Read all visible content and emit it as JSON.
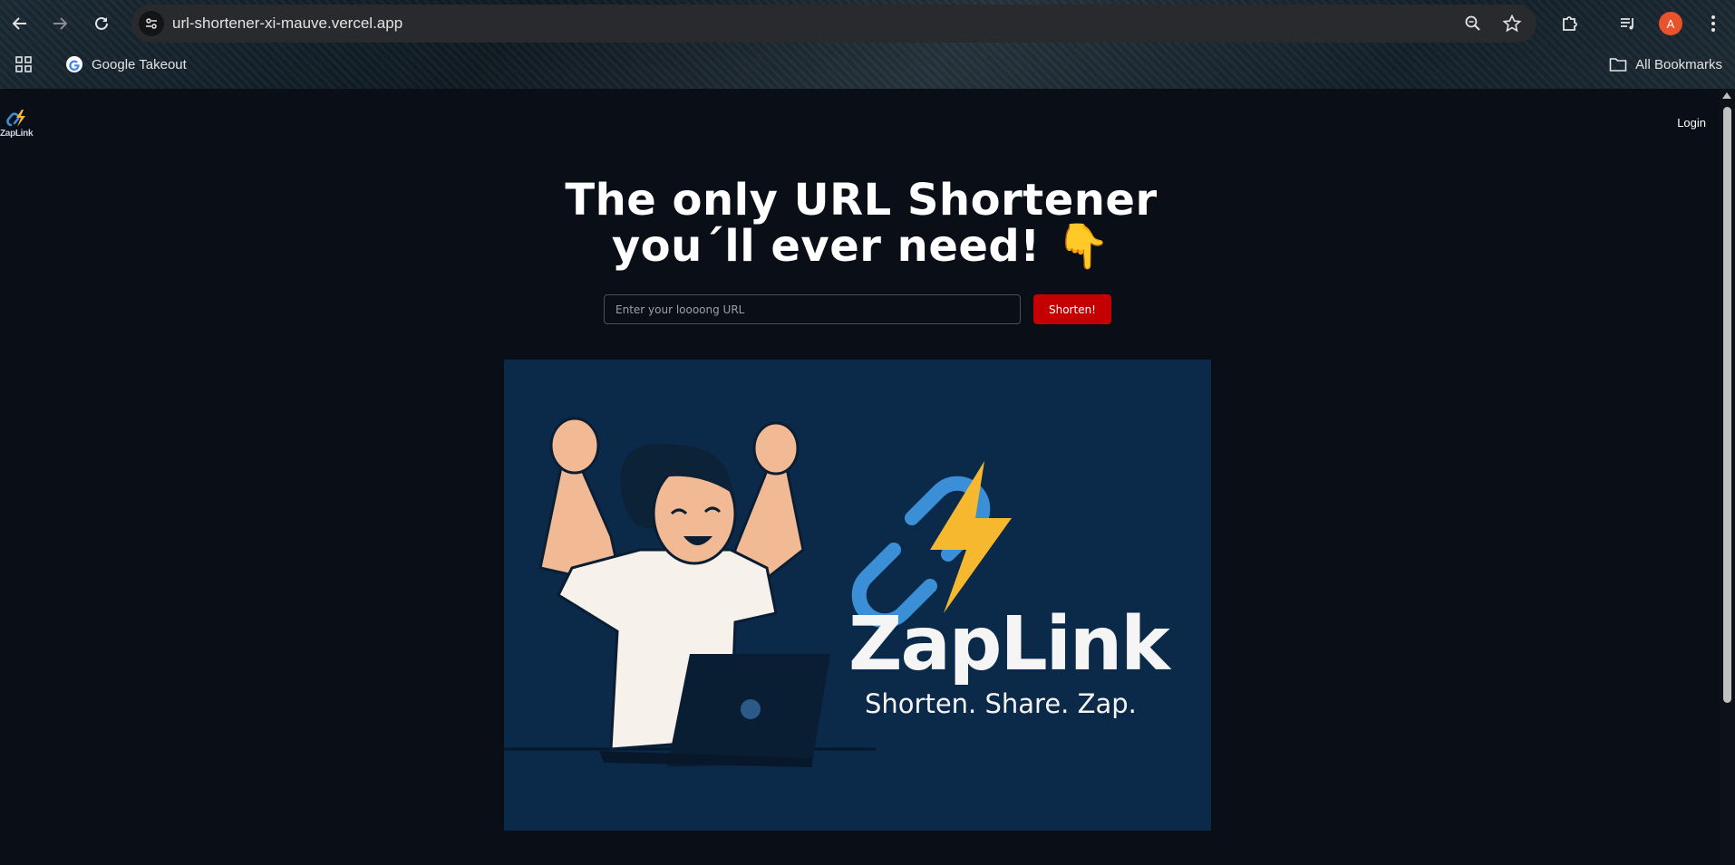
{
  "browser": {
    "url": "url-shortener-xi-mauve.vercel.app",
    "bookmarks": [
      {
        "label": "Google Takeout"
      }
    ],
    "all_bookmarks_label": "All Bookmarks",
    "profile_initial": "A"
  },
  "site": {
    "logo_text": "ZapLink",
    "nav": {
      "login_label": "Login"
    },
    "hero": {
      "headline_line1": "The only URL Shortener",
      "headline_line2": "you´ll ever need!",
      "headline_emoji": "👇"
    },
    "form": {
      "input_placeholder": "Enter your loooong URL",
      "input_value": "",
      "submit_label": "Shorten!"
    },
    "banner": {
      "brand_name": "ZapLink",
      "tagline": "Shorten. Share. Zap.",
      "background_color": "#0b2a4a"
    }
  },
  "colors": {
    "page_background": "#0a0e17",
    "accent_button": "#c40000",
    "link_blue": "#3a8fd6",
    "bolt_yellow": "#f5b82e"
  }
}
